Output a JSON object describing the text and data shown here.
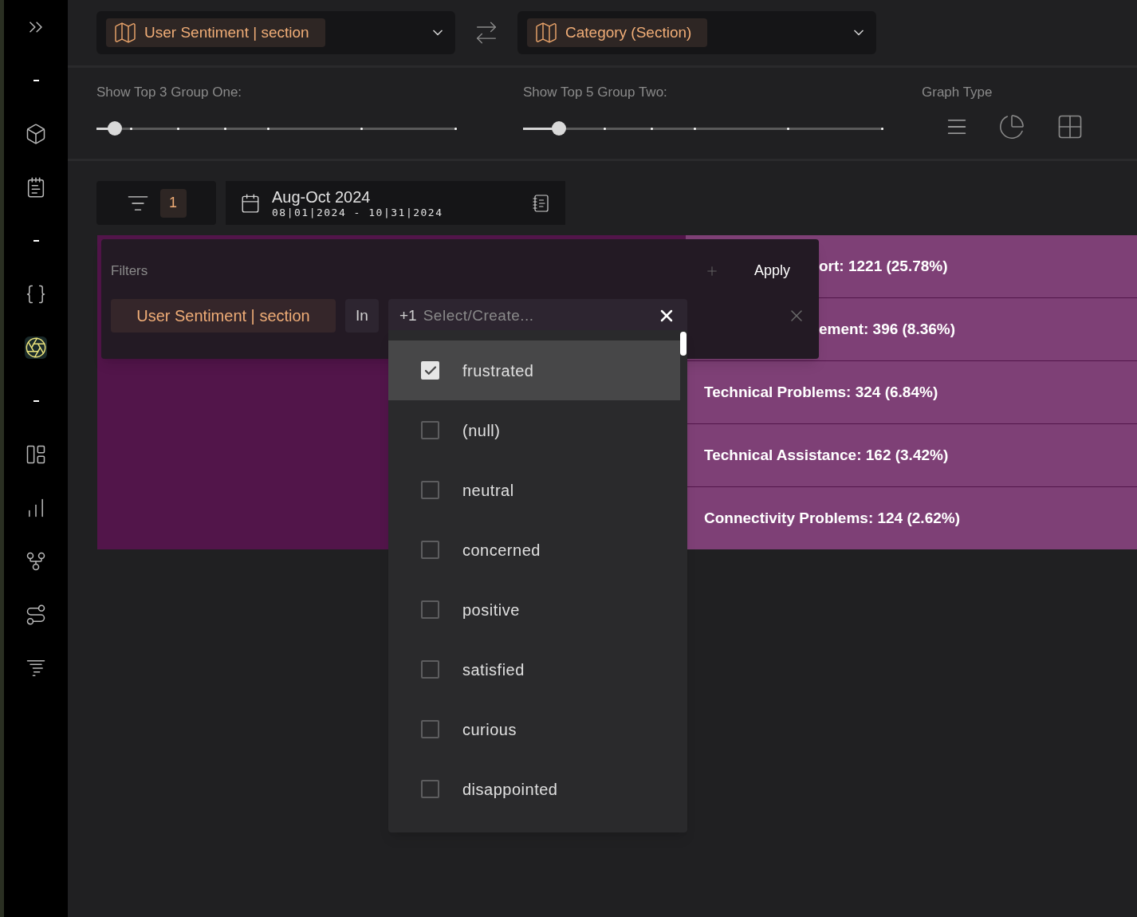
{
  "sidebar": {
    "items": [
      {
        "kind": "icon",
        "selected": false
      },
      {
        "kind": "divider"
      },
      {
        "kind": "icon",
        "selected": false
      },
      {
        "kind": "icon",
        "selected": false
      },
      {
        "kind": "divider"
      },
      {
        "kind": "icon",
        "selected": false
      },
      {
        "kind": "icon",
        "selected": true
      },
      {
        "kind": "divider"
      },
      {
        "kind": "icon",
        "selected": false
      },
      {
        "kind": "icon",
        "selected": false
      },
      {
        "kind": "icon",
        "selected": false
      },
      {
        "kind": "icon",
        "selected": false
      },
      {
        "kind": "icon",
        "selected": false
      }
    ]
  },
  "group_selectors": [
    {
      "value": "User Sentiment | section"
    },
    {
      "value": "Category (Section)"
    }
  ],
  "sliders": [
    {
      "label": "Show Top 3 Group One:",
      "level": 0.05
    },
    {
      "label": "Show Top 5 Group Two:",
      "level": 0.1
    }
  ],
  "graph_type": {
    "label": "Graph Type"
  },
  "filter_button": {
    "count": "1"
  },
  "date_range": {
    "title": "Aug-Oct 2024",
    "range": "08|01|2024 - 10|31|2024"
  },
  "chart_rows": [
    {
      "label": "ort: 1221 (25.78%)",
      "covered": true
    },
    {
      "label": "ement: 396 (8.36%)",
      "covered": true
    },
    {
      "label": "Technical Problems: 324 (6.84%)",
      "covered": false
    },
    {
      "label": "Technical Assistance: 162 (3.42%)",
      "covered": false
    },
    {
      "label": "Connectivity Problems: 124 (2.62%)",
      "covered": false
    }
  ],
  "filters_panel": {
    "title": "Filters",
    "apply": "Apply",
    "field": "User Sentiment | section",
    "operator": "In",
    "count": "+1",
    "placeholder": "Select/Create...",
    "options": [
      {
        "label": "frustrated",
        "checked": true,
        "highlighted": true
      },
      {
        "label": "(null)",
        "checked": false,
        "highlighted": false
      },
      {
        "label": "neutral",
        "checked": false,
        "highlighted": false
      },
      {
        "label": "concerned",
        "checked": false,
        "highlighted": false
      },
      {
        "label": "positive",
        "checked": false,
        "highlighted": false
      },
      {
        "label": "satisfied",
        "checked": false,
        "highlighted": false
      },
      {
        "label": "curious",
        "checked": false,
        "highlighted": false
      },
      {
        "label": "disappointed",
        "checked": false,
        "highlighted": false
      }
    ]
  }
}
